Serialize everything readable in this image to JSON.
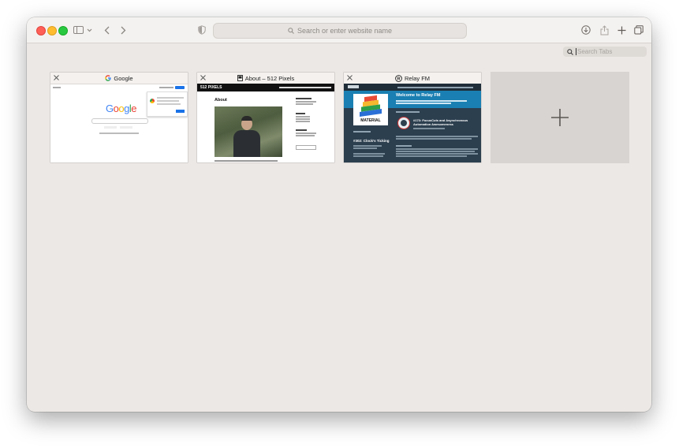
{
  "toolbar": {
    "address_placeholder": "Search or enter website name"
  },
  "tab_search": {
    "placeholder": "Search Tabs"
  },
  "tabs": [
    {
      "title": "Google",
      "favicon": "google-g-icon",
      "logo_text": "Google"
    },
    {
      "title": "About – 512 Pixels",
      "favicon": "512-pixels-icon",
      "site_name": "512 PIXELS",
      "page_heading": "About"
    },
    {
      "title": "Relay FM",
      "favicon": "relay-fm-icon",
      "hero_text": "Welcome to Relay FM",
      "book_label": "MATERIAL",
      "episode_title": "#302: Clock’s Ticking",
      "episode_title_2": "#173: FocusCuts and Asynchronous Automation Awesomeness"
    }
  ],
  "colors": {
    "window_bg": "#ece8e5",
    "relay_dark": "#2c3f4f",
    "relay_blue": "#1a7fb2"
  }
}
